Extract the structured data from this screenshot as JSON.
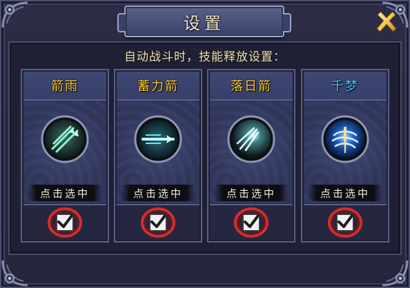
{
  "dialog": {
    "title": "设置",
    "subtitle": "自动战斗时，技能释放设置："
  },
  "skills": [
    {
      "name": "箭雨",
      "status": "点击选中",
      "checked": true,
      "name_color": "#ffcc33",
      "icon": "arrow-rain-icon"
    },
    {
      "name": "蓄力箭",
      "status": "点击选中",
      "checked": true,
      "name_color": "#ffcc33",
      "icon": "charged-arrow-icon"
    },
    {
      "name": "落日箭",
      "status": "点击选中",
      "checked": true,
      "name_color": "#ffcc33",
      "icon": "sunset-arrow-icon"
    },
    {
      "name": "千梦",
      "status": "点击选中",
      "checked": true,
      "name_color": "#4fc3ff",
      "icon": "thousand-dreams-icon"
    }
  ],
  "colors": {
    "accent_gold": "#ffcc33",
    "accent_blue": "#4fc3ff",
    "checkbox_ring": "#d92b2b"
  }
}
